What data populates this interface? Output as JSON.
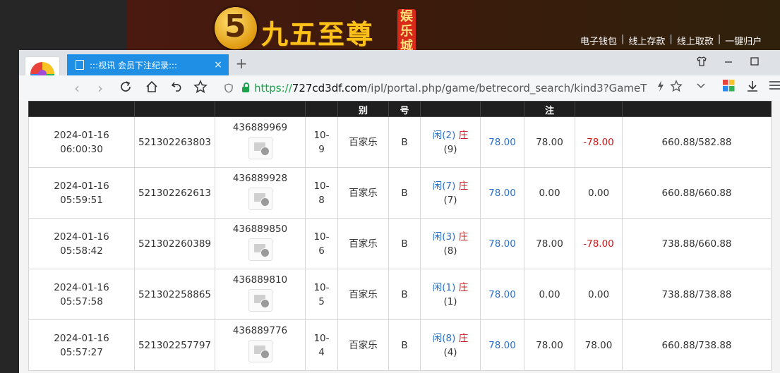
{
  "site": {
    "logo_numeral": "5",
    "logo_text": "九五至尊",
    "logo_tag": [
      "娱",
      "乐",
      "城"
    ],
    "header_links": [
      "电子钱包",
      "线上存款",
      "线上取款",
      "一键归户"
    ]
  },
  "browser": {
    "tab_title": ":::视讯 会员下注纪录:::",
    "tab_close": "×",
    "new_tab": "+",
    "url_scheme": "https://",
    "url_host": "727cd3df.com",
    "url_path": "/ipl/portal.php/game/betrecord_search/kind3?GameT"
  },
  "table": {
    "headers": [
      "",
      "",
      "",
      "",
      "别",
      "号",
      "",
      "",
      "注",
      "",
      ""
    ],
    "rows": [
      {
        "date": "2024-01-16",
        "time": "06:00:30",
        "order": "521302263803",
        "game_id": "436889969",
        "round_a": "10-",
        "round_b": "9",
        "game": "百家乐",
        "table": "B",
        "player": "闲(2)",
        "banker": "庄",
        "banker_val": "(9)",
        "bet": "78.00",
        "valid": "78.00",
        "result": "-78.00",
        "result_neg": true,
        "balance": "660.88/582.88"
      },
      {
        "date": "2024-01-16",
        "time": "05:59:51",
        "order": "521302262613",
        "game_id": "436889928",
        "round_a": "10-",
        "round_b": "8",
        "game": "百家乐",
        "table": "B",
        "player": "闲(7)",
        "banker": "庄",
        "banker_val": "(7)",
        "bet": "78.00",
        "valid": "0.00",
        "result": "0.00",
        "result_neg": false,
        "balance": "660.88/660.88"
      },
      {
        "date": "2024-01-16",
        "time": "05:58:42",
        "order": "521302260389",
        "game_id": "436889850",
        "round_a": "10-",
        "round_b": "6",
        "game": "百家乐",
        "table": "B",
        "player": "闲(3)",
        "banker": "庄",
        "banker_val": "(8)",
        "bet": "78.00",
        "valid": "78.00",
        "result": "-78.00",
        "result_neg": true,
        "balance": "738.88/660.88"
      },
      {
        "date": "2024-01-16",
        "time": "05:57:58",
        "order": "521302258865",
        "game_id": "436889810",
        "round_a": "10-",
        "round_b": "5",
        "game": "百家乐",
        "table": "B",
        "player": "闲(1)",
        "banker": "庄",
        "banker_val": "(1)",
        "bet": "78.00",
        "valid": "0.00",
        "result": "0.00",
        "result_neg": false,
        "balance": "738.88/738.88"
      },
      {
        "date": "2024-01-16",
        "time": "05:57:27",
        "order": "521302257797",
        "game_id": "436889776",
        "round_a": "10-",
        "round_b": "4",
        "game": "百家乐",
        "table": "B",
        "player": "闲(8)",
        "banker": "庄",
        "banker_val": "(4)",
        "bet": "78.00",
        "valid": "78.00",
        "result": "78.00",
        "result_neg": false,
        "balance": "660.88/738.88"
      }
    ]
  },
  "colors": {
    "tab_active": "#1e8fe5",
    "url_secure": "#1aa34a",
    "value_blue": "#2b6fc9",
    "value_red": "#d01818",
    "header_bg": "#1f1f1f"
  },
  "icons": [
    "browser-logo-icon",
    "doc-icon",
    "close-icon",
    "plus-icon",
    "shirt-icon",
    "minimize-icon",
    "maximize-icon",
    "back-icon",
    "forward-icon",
    "reload-icon",
    "home-icon",
    "undo-icon",
    "star-icon",
    "shield-icon",
    "lock-icon",
    "lightning-icon",
    "chevron-down-icon",
    "apps-icon",
    "download-icon",
    "menu-icon",
    "video-replay-icon"
  ]
}
